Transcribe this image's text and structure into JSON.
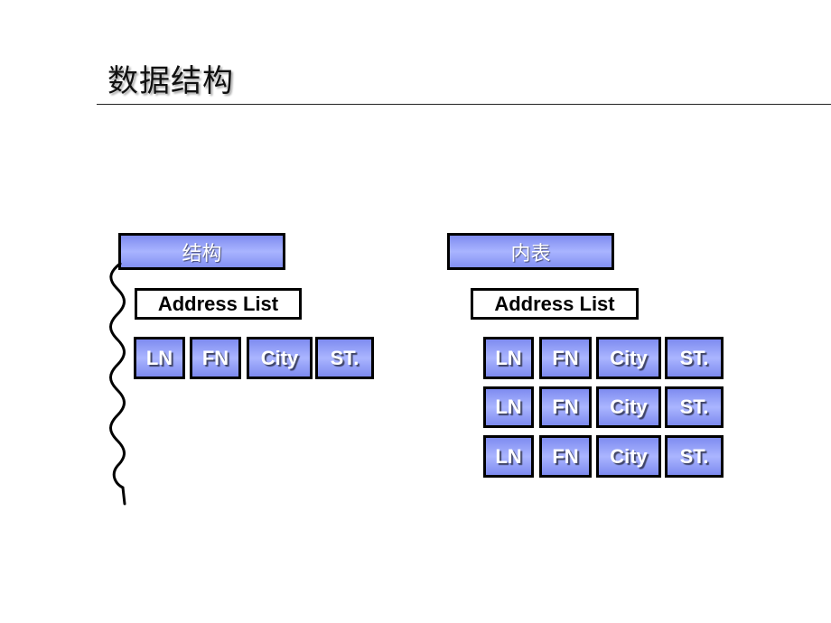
{
  "page": {
    "title": "数据结构"
  },
  "left": {
    "header": "结构",
    "list_label": "Address List",
    "rows": [
      [
        "LN",
        "FN",
        "City",
        "ST."
      ]
    ]
  },
  "right": {
    "header": "内表",
    "list_label": "Address List",
    "rows": [
      [
        "LN",
        "FN",
        "City",
        "ST."
      ],
      [
        "LN",
        "FN",
        "City",
        "ST."
      ],
      [
        "LN",
        "FN",
        "City",
        "ST."
      ]
    ]
  },
  "colors": {
    "box_blue": "#a9b4ff",
    "border": "#000000"
  }
}
